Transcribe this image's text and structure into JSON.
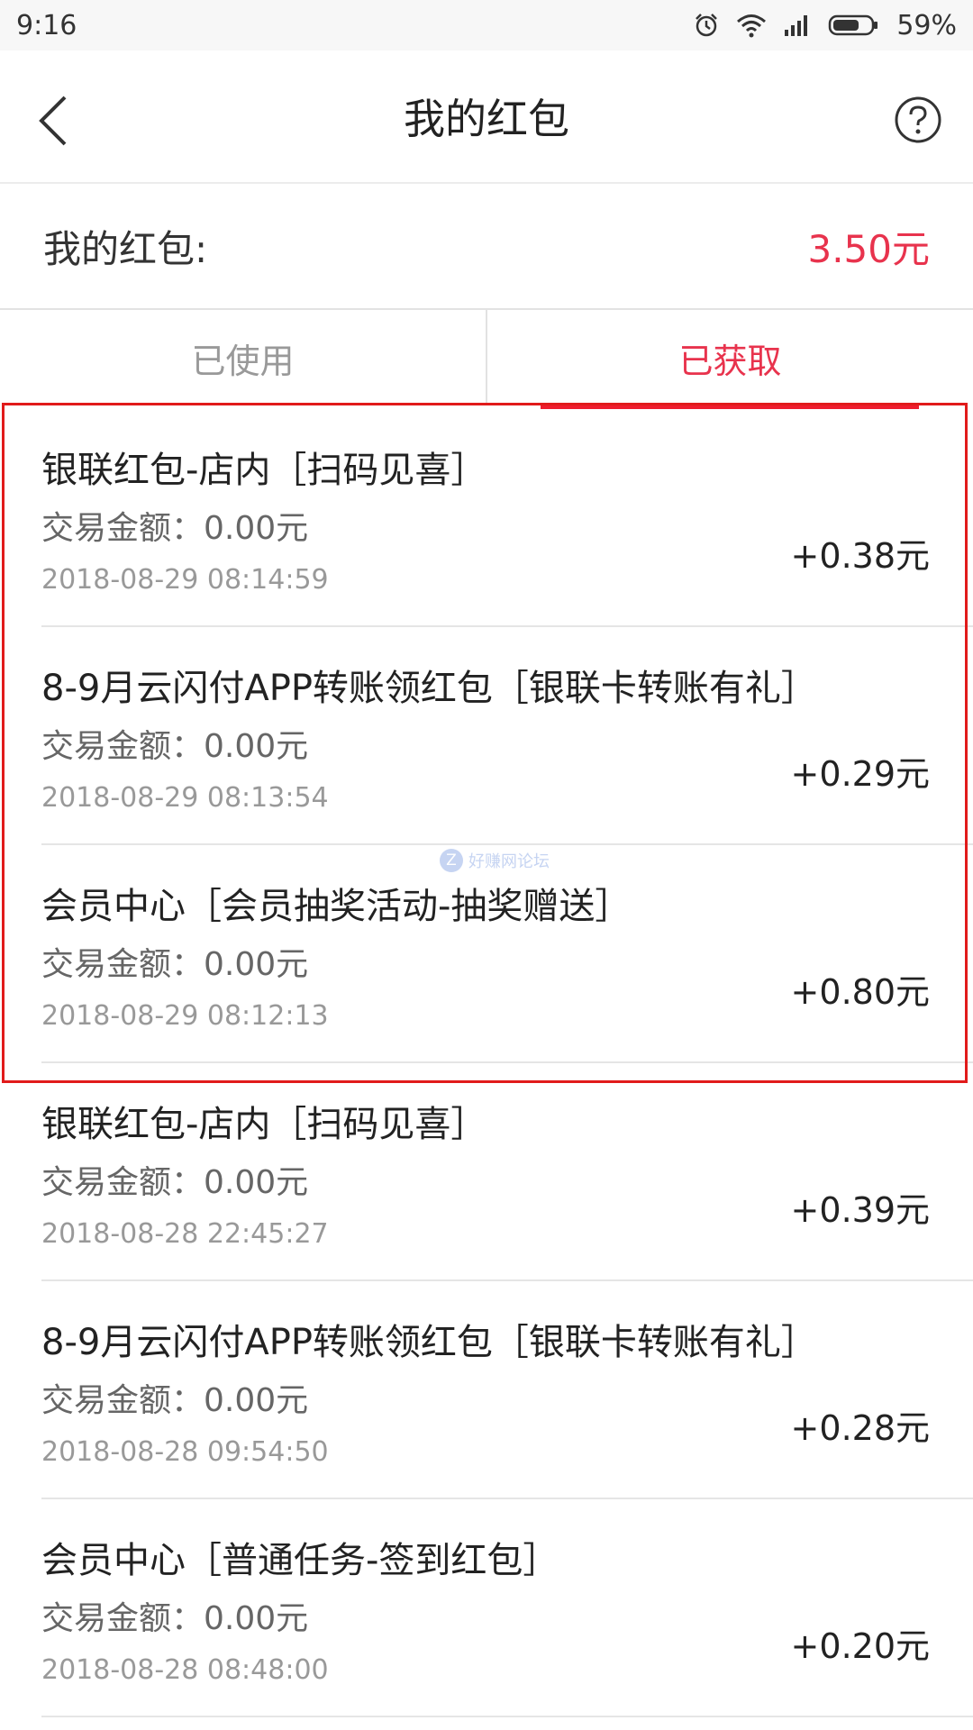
{
  "status_bar": {
    "time": "9:16",
    "battery": "59%",
    "icons": [
      "alarm-icon",
      "wifi-icon",
      "signal-icon",
      "battery-icon"
    ]
  },
  "header": {
    "title": "我的红包",
    "back_icon": "chevron-left-icon",
    "help_icon": "help-circle-icon"
  },
  "summary": {
    "label": "我的红包:",
    "amount": "3.50元",
    "amount_color": "#e8334d"
  },
  "tabs": [
    {
      "label": "已使用",
      "active": false
    },
    {
      "label": "已获取",
      "active": true
    }
  ],
  "items": [
    {
      "title": "银联红包-店内［扫码见喜］",
      "amount_label": "交易金额：",
      "amount_value": "0.00元",
      "time": "2018-08-29 08:14:59",
      "reward": "+0.38元"
    },
    {
      "title": "8-9月云闪付APP转账领红包［银联卡转账有礼］",
      "amount_label": "交易金额：",
      "amount_value": "0.00元",
      "time": "2018-08-29 08:13:54",
      "reward": "+0.29元"
    },
    {
      "title": "会员中心［会员抽奖活动-抽奖赠送］",
      "amount_label": "交易金额：",
      "amount_value": "0.00元",
      "time": "2018-08-29 08:12:13",
      "reward": "+0.80元"
    },
    {
      "title": "银联红包-店内［扫码见喜］",
      "amount_label": "交易金额：",
      "amount_value": "0.00元",
      "time": "2018-08-28 22:45:27",
      "reward": "+0.39元"
    },
    {
      "title": "8-9月云闪付APP转账领红包［银联卡转账有礼］",
      "amount_label": "交易金额：",
      "amount_value": "0.00元",
      "time": "2018-08-28 09:54:50",
      "reward": "+0.28元"
    },
    {
      "title": "会员中心［普通任务-签到红包］",
      "amount_label": "交易金额：",
      "amount_value": "0.00元",
      "time": "2018-08-28 08:48:00",
      "reward": "+0.20元"
    }
  ],
  "annotation": {
    "highlight_color": "#e11b1b"
  },
  "watermark": {
    "icon_letter": "Z",
    "text": "好赚网论坛"
  }
}
